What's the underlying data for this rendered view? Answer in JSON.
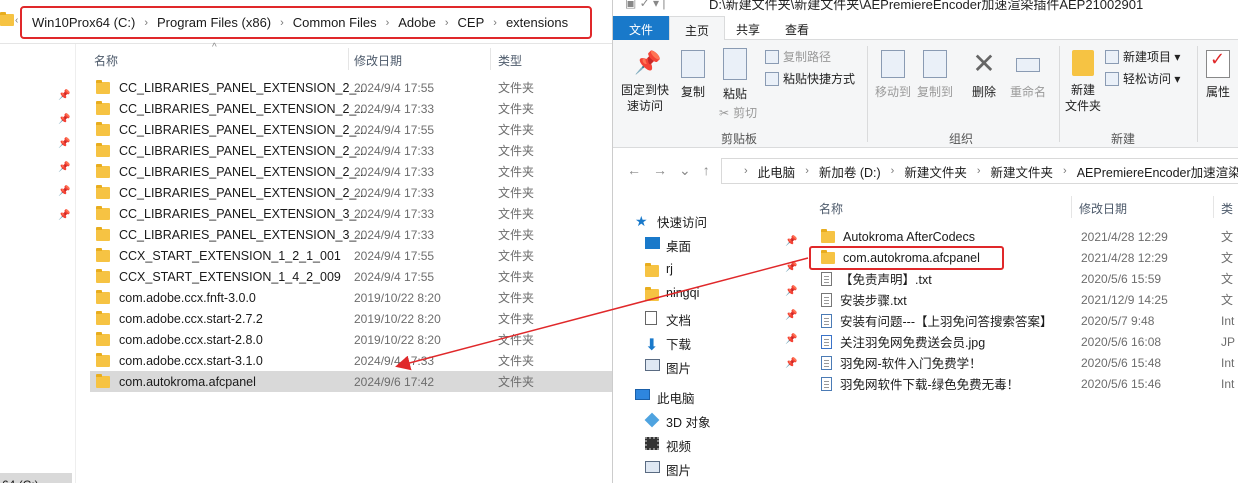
{
  "left": {
    "breadcrumb": [
      "Win10Prox64 (C:)",
      "Program Files (x86)",
      "Common Files",
      "Adobe",
      "CEP",
      "extensions"
    ],
    "columns": {
      "name": "名称",
      "date": "修改日期",
      "type": "类型"
    },
    "sort_caret": "^",
    "drive_label": "64 (C:)",
    "files": [
      {
        "name": "CC_LIBRARIES_PANEL_EXTENSION_2_...",
        "date": "2024/9/4 17:55",
        "type": "文件夹"
      },
      {
        "name": "CC_LIBRARIES_PANEL_EXTENSION_2_...",
        "date": "2024/9/4 17:33",
        "type": "文件夹"
      },
      {
        "name": "CC_LIBRARIES_PANEL_EXTENSION_2_...",
        "date": "2024/9/4 17:55",
        "type": "文件夹"
      },
      {
        "name": "CC_LIBRARIES_PANEL_EXTENSION_2_...",
        "date": "2024/9/4 17:33",
        "type": "文件夹"
      },
      {
        "name": "CC_LIBRARIES_PANEL_EXTENSION_2_...",
        "date": "2024/9/4 17:33",
        "type": "文件夹"
      },
      {
        "name": "CC_LIBRARIES_PANEL_EXTENSION_2_...",
        "date": "2024/9/4 17:33",
        "type": "文件夹"
      },
      {
        "name": "CC_LIBRARIES_PANEL_EXTENSION_3_...",
        "date": "2024/9/4 17:33",
        "type": "文件夹"
      },
      {
        "name": "CC_LIBRARIES_PANEL_EXTENSION_3_...",
        "date": "2024/9/4 17:33",
        "type": "文件夹"
      },
      {
        "name": "CCX_START_EXTENSION_1_2_1_001",
        "date": "2024/9/4 17:55",
        "type": "文件夹"
      },
      {
        "name": "CCX_START_EXTENSION_1_4_2_009",
        "date": "2024/9/4 17:55",
        "type": "文件夹"
      },
      {
        "name": "com.adobe.ccx.fnft-3.0.0",
        "date": "2019/10/22 8:20",
        "type": "文件夹"
      },
      {
        "name": "com.adobe.ccx.start-2.7.2",
        "date": "2019/10/22 8:20",
        "type": "文件夹"
      },
      {
        "name": "com.adobe.ccx.start-2.8.0",
        "date": "2019/10/22 8:20",
        "type": "文件夹"
      },
      {
        "name": "com.adobe.ccx.start-3.1.0",
        "date": "2024/9/4 17:33",
        "type": "文件夹"
      },
      {
        "name": "com.autokroma.afcpanel",
        "date": "2024/9/6 17:42",
        "type": "文件夹"
      }
    ]
  },
  "right": {
    "title": "D:\\新建文件夹\\新建文件夹\\AEPremiereEncoder加速渲染插件AEP21002901",
    "tabs": {
      "file": "文件",
      "home": "主页",
      "share": "共享",
      "view": "查看"
    },
    "ribbon": {
      "pin_quick": "固定到快\n速访问",
      "copy": "复制",
      "paste": "粘贴",
      "copy_path": "复制路径",
      "paste_shortcut": "粘贴快捷方式",
      "cut": "剪切",
      "clipboard_group": "剪贴板",
      "move_to": "移动到",
      "copy_to": "复制到",
      "delete": "删除",
      "rename": "重命名",
      "organize_group": "组织",
      "new_folder": "新建\n文件夹",
      "new_item": "新建项目 ▾",
      "easy_access": "轻松访问 ▾",
      "new_group": "新建",
      "properties": "属性"
    },
    "breadcrumb": [
      "此电脑",
      "新加卷 (D:)",
      "新建文件夹",
      "新建文件夹",
      "AEPremiereEncoder加速渲染"
    ],
    "nav": [
      {
        "label": "快速访问",
        "icon": "star-icon",
        "pinned": false
      },
      {
        "label": "桌面",
        "icon": "desktop-icon",
        "pinned": true
      },
      {
        "label": "rj",
        "icon": "folder-icon",
        "pinned": true
      },
      {
        "label": "ningqi",
        "icon": "folder-icon",
        "pinned": true
      },
      {
        "label": "文档",
        "icon": "document-icon",
        "pinned": true
      },
      {
        "label": "下载",
        "icon": "download-icon",
        "pinned": true
      },
      {
        "label": "图片",
        "icon": "pictures-icon",
        "pinned": true
      },
      {
        "label": "此电脑",
        "icon": "computer-icon",
        "pinned": false
      },
      {
        "label": "3D 对象",
        "icon": "3d-objects-icon",
        "pinned": false
      },
      {
        "label": "视频",
        "icon": "video-icon",
        "pinned": false
      },
      {
        "label": "图片",
        "icon": "pictures-icon",
        "pinned": false
      }
    ],
    "columns": {
      "name": "名称",
      "date": "修改日期",
      "type": "类"
    },
    "files": [
      {
        "name": "Autokroma AfterCodecs",
        "date": "2021/4/28 12:29",
        "type": "文",
        "icon": "folder"
      },
      {
        "name": "com.autokroma.afcpanel",
        "date": "2021/4/28 12:29",
        "type": "文",
        "icon": "folder"
      },
      {
        "name": "【免责声明】.txt",
        "date": "2020/5/6 15:59",
        "type": "文",
        "icon": "txt"
      },
      {
        "name": "安装步骤.txt",
        "date": "2021/12/9 14:25",
        "type": "文",
        "icon": "txt"
      },
      {
        "name": "安装有问题---【上羽免问答搜索答案】",
        "date": "2020/5/7 9:48",
        "type": "Int",
        "icon": "url"
      },
      {
        "name": "关注羽免网免费送会员.jpg",
        "date": "2020/5/6 16:08",
        "type": "JP",
        "icon": "jpg"
      },
      {
        "name": "羽免网-软件入门免费学！",
        "date": "2020/5/6 15:48",
        "type": "Int",
        "icon": "url"
      },
      {
        "name": "羽免网软件下载-绿色免费无毒！",
        "date": "2020/5/6 15:46",
        "type": "Int",
        "icon": "url"
      }
    ]
  },
  "colors": {
    "highlight_red": "#e0282a",
    "accent_blue": "#1979ca",
    "selection_gray": "#d9d9d9"
  }
}
